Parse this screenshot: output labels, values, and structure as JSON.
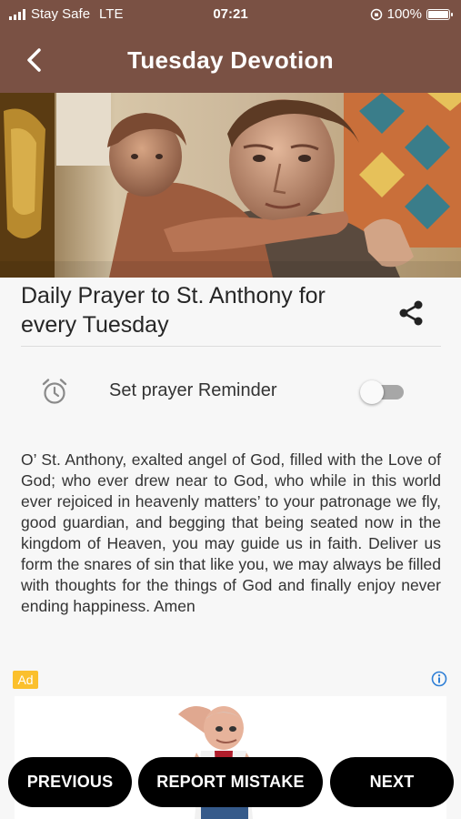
{
  "status": {
    "carrier": "Stay Safe",
    "network": "LTE",
    "time": "07:21",
    "battery": "100%",
    "battery_level": 1.0
  },
  "header": {
    "title": "Tuesday Devotion",
    "back_icon": "chevron-left-icon",
    "background": "#7a5144"
  },
  "prayer": {
    "title": "Daily Prayer to St. Anthony for every Tuesday",
    "share_icon": "share-icon",
    "body": "O’ St. Anthony, exalted angel of God, filled with the Love of God; who ever drew near to God, who while in this world ever rejoiced in heavenly matters’ to your  patronage we fly, good guardian, and begging that being seated now in the kingdom of Heaven, you may guide us in faith. Deliver  us form the snares of sin that like you, we may always be filled with thoughts for the things of God and finally enjoy never ending happiness. Amen"
  },
  "reminder": {
    "label": "Set prayer Reminder",
    "icon": "alarm-clock-icon",
    "enabled": false
  },
  "ad": {
    "badge": "Ad",
    "badge_color": "#fbc02d",
    "info_icon": "info-icon"
  },
  "nav": {
    "previous": "PREVIOUS",
    "report": "REPORT MISTAKE",
    "next": "NEXT"
  }
}
